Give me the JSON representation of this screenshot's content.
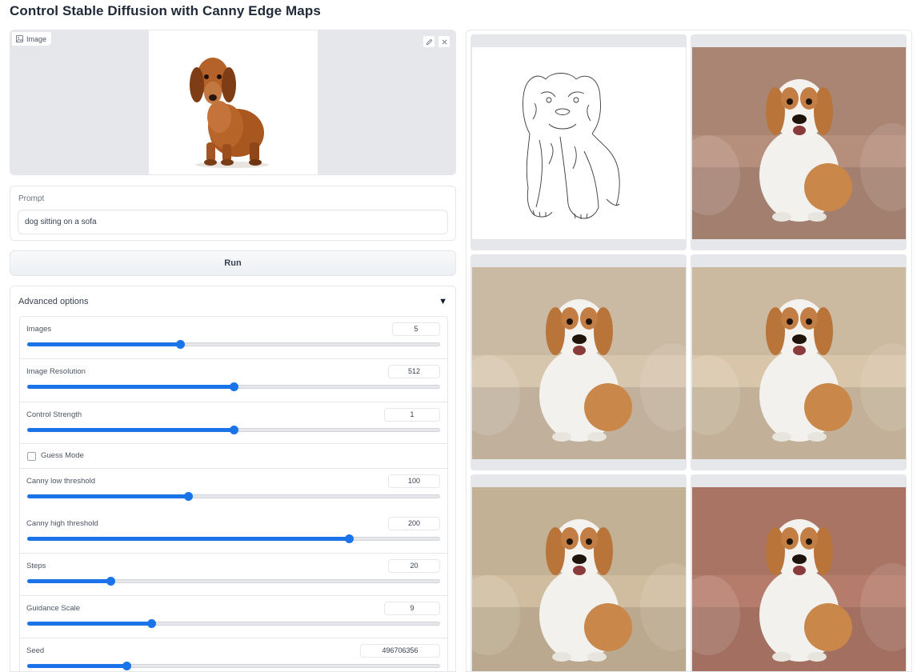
{
  "app": {
    "title": "Control Stable Diffusion with Canny Edge Maps"
  },
  "input_image": {
    "label": "Image",
    "tools": [
      "edit-icon",
      "close-icon"
    ]
  },
  "prompt": {
    "label": "Prompt",
    "value": "dog sitting on a sofa"
  },
  "run": {
    "label": "Run"
  },
  "advanced": {
    "label": "Advanced options",
    "images": {
      "label": "Images",
      "value": "5",
      "fraction": 0.37
    },
    "resolution": {
      "label": "Image Resolution",
      "value": "512",
      "fraction": 0.5
    },
    "strength": {
      "label": "Control Strength",
      "value": "1",
      "fraction": 0.5
    },
    "guess_mode": {
      "label": "Guess Mode",
      "checked": false
    },
    "low_threshold": {
      "label": "Canny low threshold",
      "value": "100",
      "fraction": 0.39
    },
    "high_threshold": {
      "label": "Canny high threshold",
      "value": "200",
      "fraction": 0.78
    },
    "steps": {
      "label": "Steps",
      "value": "20",
      "fraction": 0.2
    },
    "guidance": {
      "label": "Guidance Scale",
      "value": "9",
      "fraction": 0.3
    },
    "seed": {
      "label": "Seed",
      "value": "496706356",
      "fraction": 0.24
    }
  },
  "gallery": {
    "items": [
      {
        "kind": "edge-map"
      },
      {
        "kind": "dog-on-sofa",
        "sofa": "#b58e7c"
      },
      {
        "kind": "dog-on-sofa",
        "sofa": "#d7c6ae"
      },
      {
        "kind": "dog-on-sofa",
        "sofa": "#d9c6aa"
      },
      {
        "kind": "dog-on-sofa",
        "sofa": "#d0bd9f"
      },
      {
        "kind": "dog-on-sofa",
        "sofa": "#b57c6c"
      }
    ]
  },
  "colors": {
    "accent": "#1a73e8",
    "border": "#e5e7eb",
    "panel": "#e5e7eb"
  }
}
